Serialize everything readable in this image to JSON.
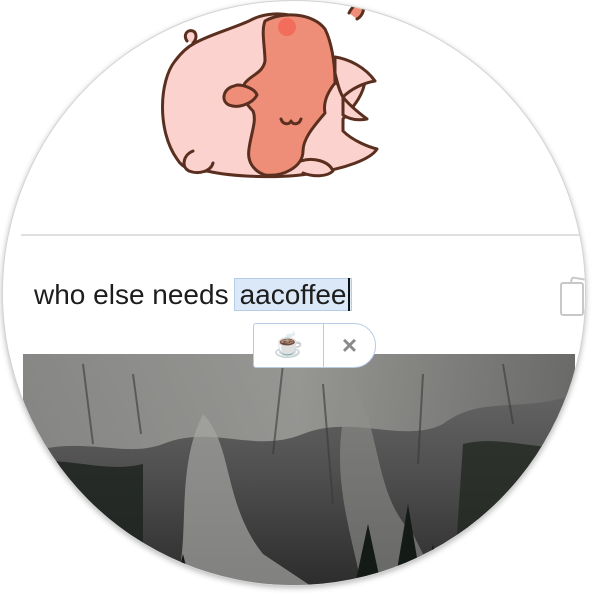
{
  "composer": {
    "text_before": "who else needs",
    "highlighted_word": "aacoffee"
  },
  "emoji_suggestion": {
    "emoji": "☕",
    "dismiss_symbol": "×"
  },
  "icons": {
    "sticker": "dragon-sticker",
    "attach": "attach-photos-icon",
    "close": "close-icon",
    "coffee": "coffee-emoji"
  },
  "colors": {
    "highlight_bg": "#dbe8f7",
    "highlight_border": "#b6cde8",
    "dragon_body": "#fbd2cd",
    "dragon_fur": "#ef8e78",
    "outline": "#5a2f1f"
  }
}
